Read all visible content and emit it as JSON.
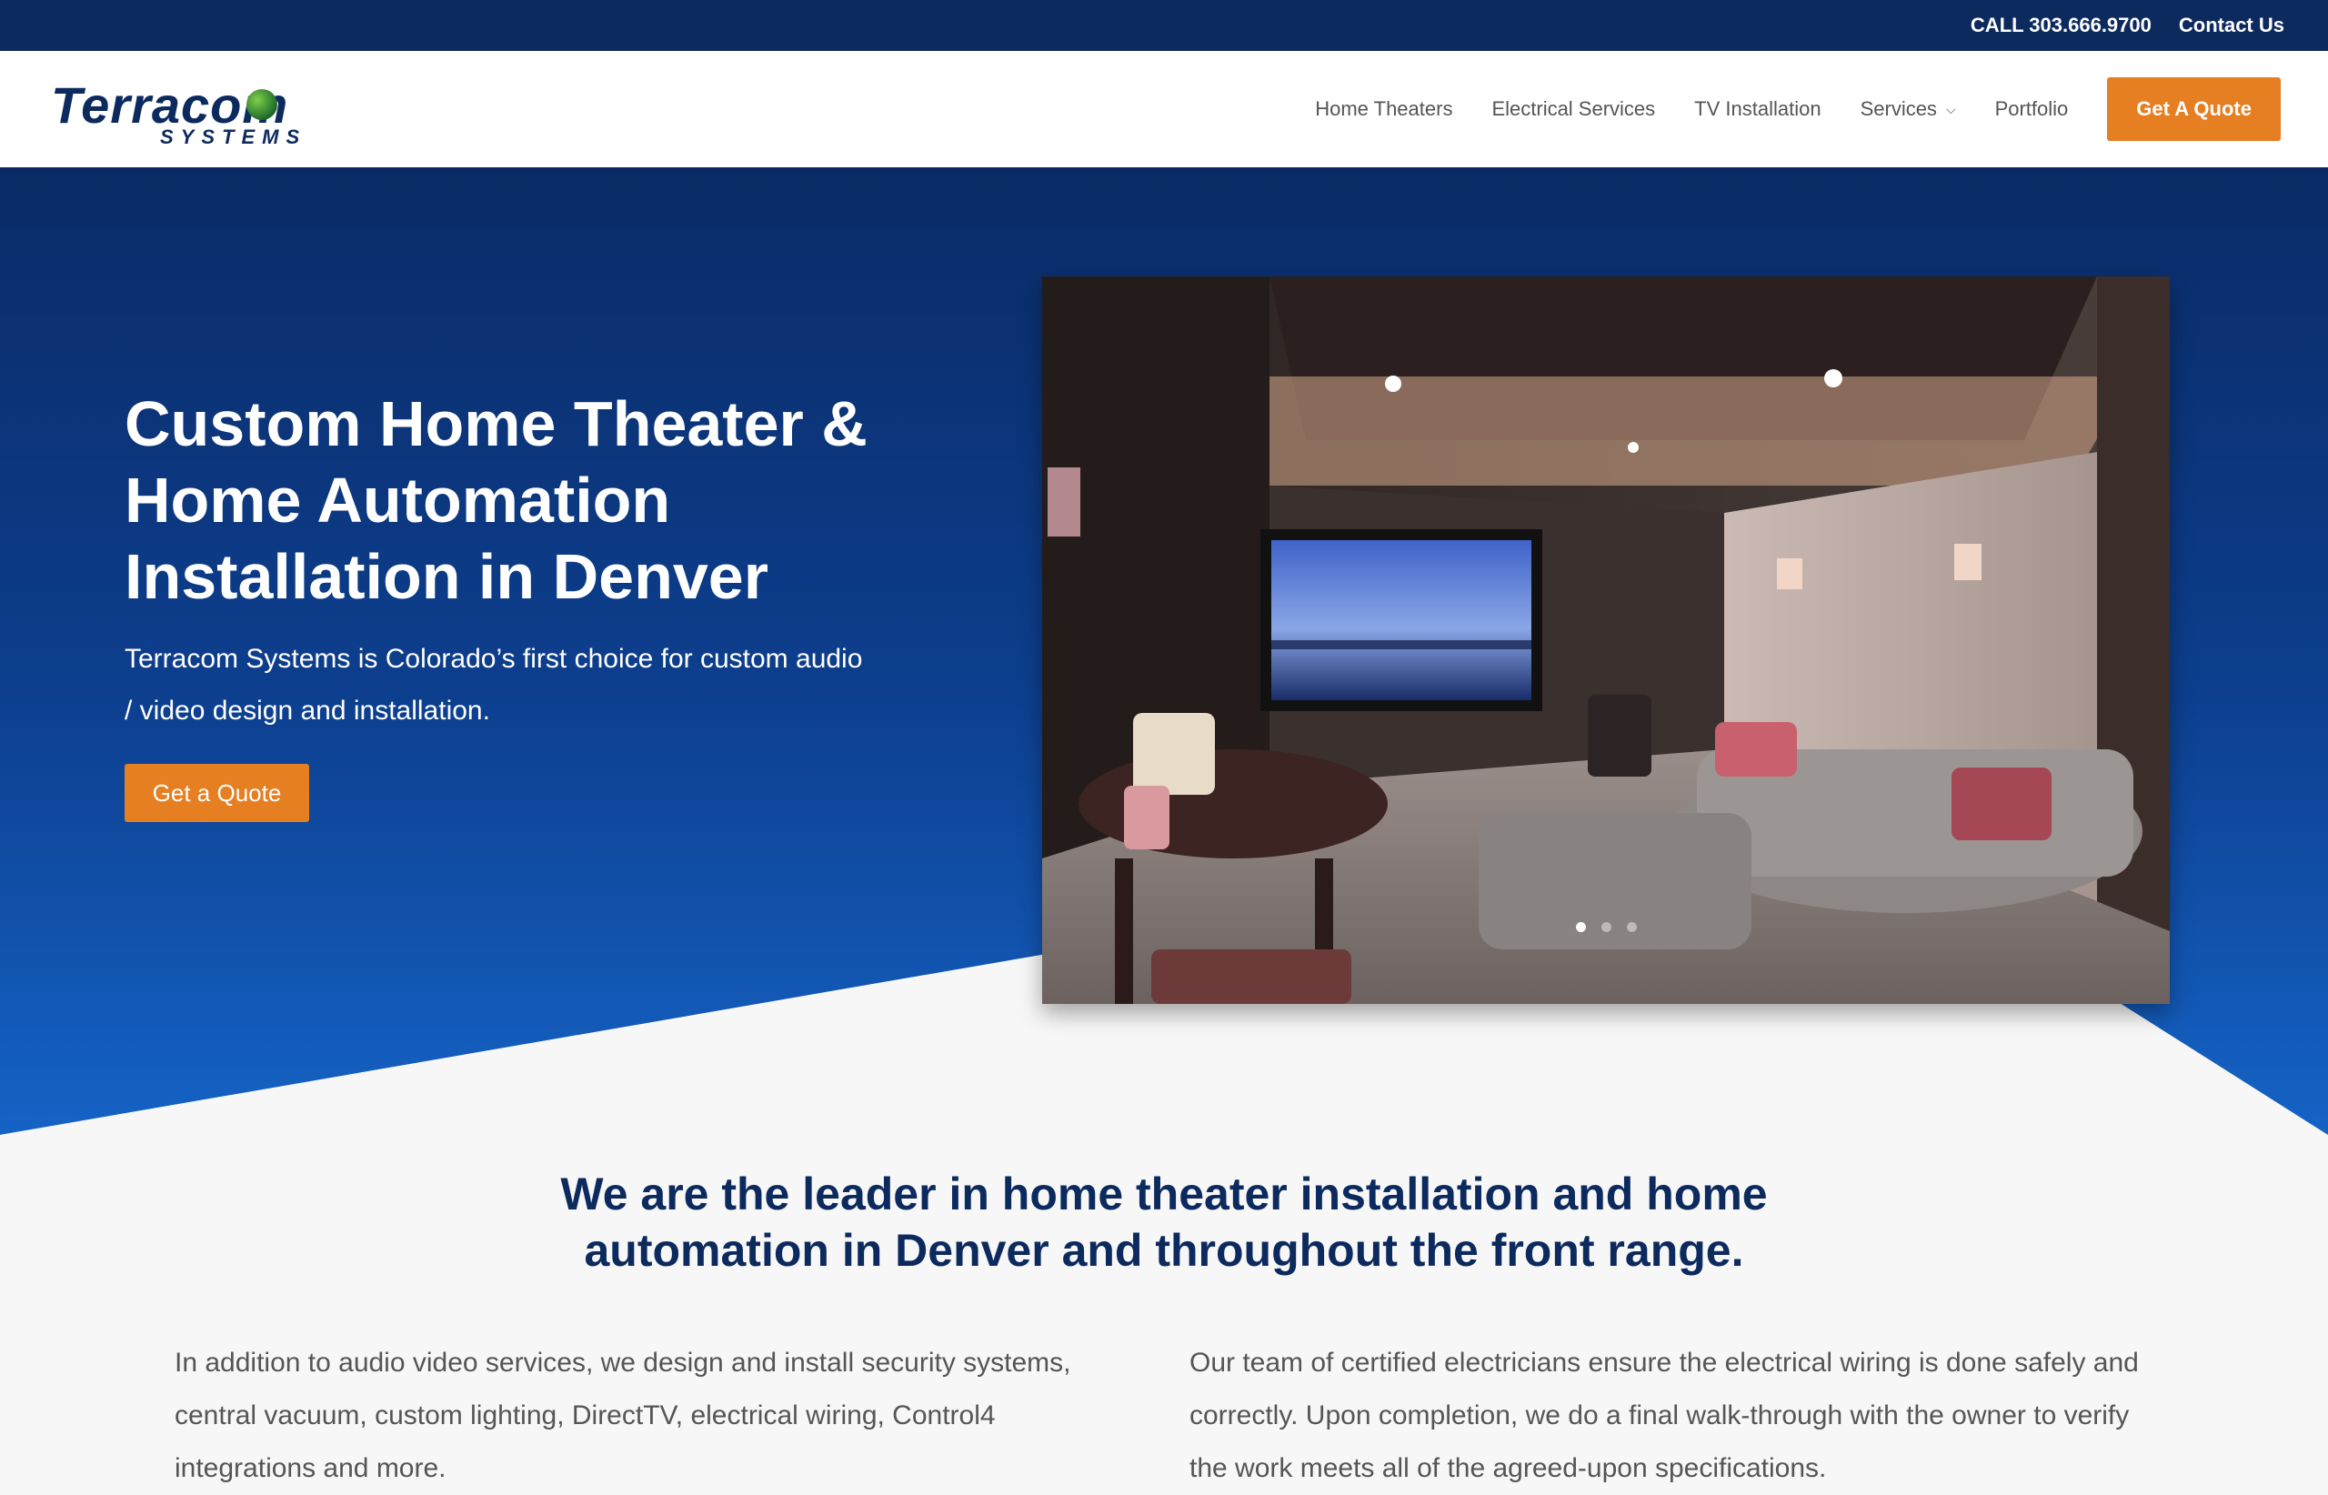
{
  "topbar": {
    "phone": "CALL 303.666.9700",
    "contact": "Contact Us"
  },
  "brand": {
    "name": "Terracom",
    "sub": "SYSTEMS"
  },
  "nav": {
    "items": [
      {
        "label": "Home Theaters"
      },
      {
        "label": "Electrical Services"
      },
      {
        "label": "TV Installation"
      },
      {
        "label": "Services",
        "has_dropdown": true
      },
      {
        "label": "Portfolio"
      }
    ],
    "quote_button": "Get A Quote"
  },
  "hero": {
    "title": "Custom Home Theater & Home Automation Installation in Denver",
    "lead": "Terracom Systems is Colorado’s first choice for custom audio / video design and installation.",
    "cta": "Get a Quote",
    "slider": {
      "total_slides": 3,
      "active_slide": 1
    }
  },
  "intro": {
    "line1": "We are the leader in home theater installation and home",
    "line2": "automation in Denver and throughout the front range."
  },
  "columns": [
    {
      "text": "In addition to audio video services, we design and install security systems, central vacuum, custom lighting, DirectTV, electrical wiring, Control4 integrations and more."
    },
    {
      "text": "Our team of certified electricians ensure the electrical wiring is done safely and correctly. Upon completion, we do a final walk-through with the owner to verify the work meets all of the agreed-upon specifications."
    }
  ],
  "colors": {
    "navy": "#0c2a5e",
    "accent": "#e67e22",
    "hero_bottom": "#1563c6"
  }
}
